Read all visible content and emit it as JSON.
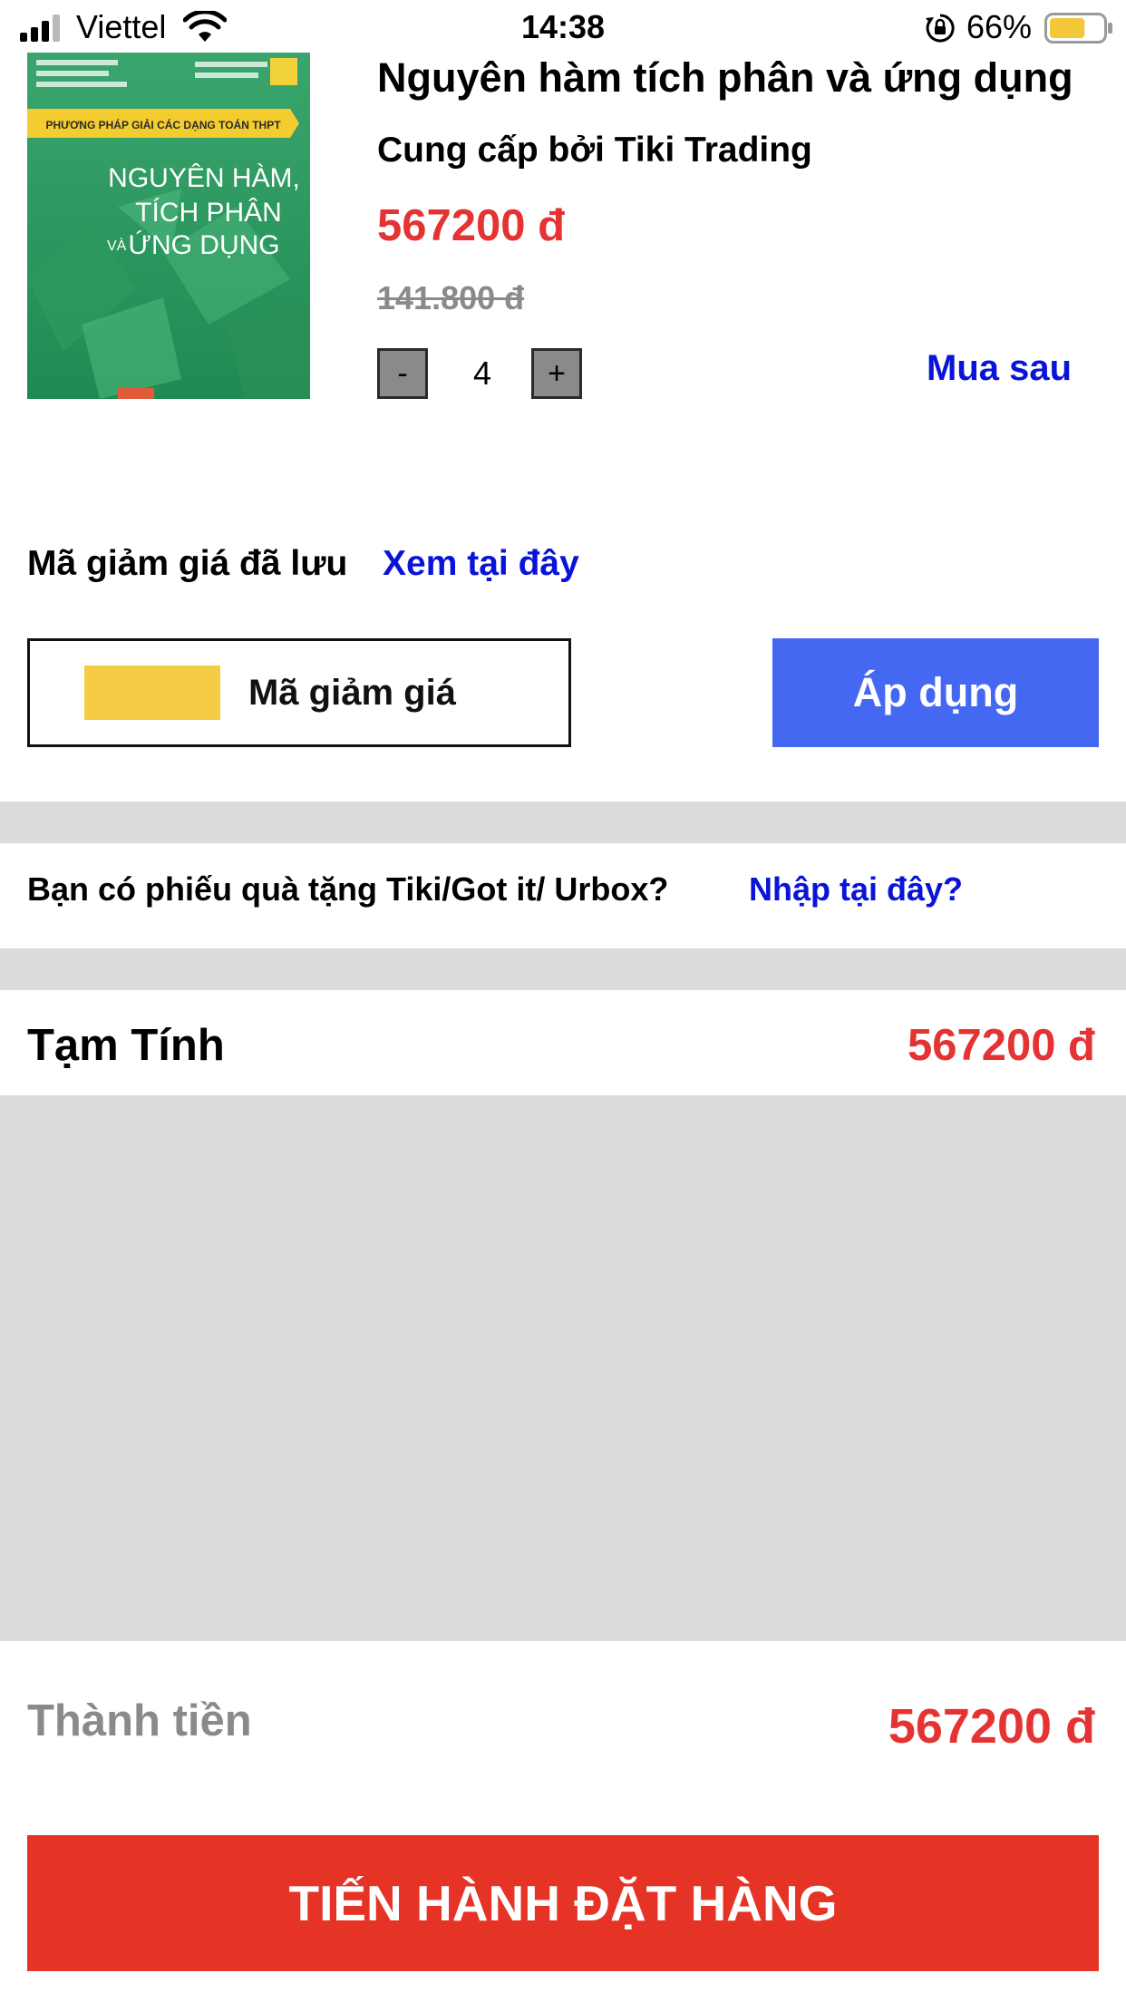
{
  "status_bar": {
    "carrier": "Viettel",
    "time": "14:38",
    "battery": "66%",
    "battery_level": 0.66,
    "icons": [
      "signal-icon",
      "wifi-icon",
      "orientation-lock-icon",
      "battery-icon"
    ]
  },
  "product": {
    "cover": {
      "series": "PHƯƠNG PHÁP GIẢI CÁC DẠNG TOÁN THPT",
      "line1": "NGUYÊN HÀM,",
      "line2": "TÍCH PHÂN",
      "line3_small": "VÀ",
      "line3": "ỨNG DỤNG"
    },
    "title": "Nguyên hàm tích phân và ứng dụng",
    "seller": "Cung cấp bởi Tiki Trading",
    "price": "567200 đ",
    "old_price": "141.800 đ",
    "quantity": "4",
    "minus_label": "-",
    "plus_label": "+",
    "buy_later": "Mua sau"
  },
  "coupon": {
    "saved_label": "Mã giảm giá đã lưu",
    "saved_link": "Xem tại đây",
    "placeholder": "Mã giảm giá",
    "apply_label": "Áp dụng"
  },
  "gift": {
    "question": "Bạn có phiếu quà tặng Tiki/Got it/ Urbox?",
    "link": "Nhập tại đây?"
  },
  "subtotal": {
    "label": "Tạm Tính",
    "value": "567200 đ"
  },
  "total": {
    "label": "Thành tiền",
    "value": "567200 đ"
  },
  "checkout_label": "TIẾN HÀNH ĐẶT HÀNG",
  "colors": {
    "price_red": "#e53333",
    "link_blue": "#0a14d8",
    "apply_blue": "#4468f1",
    "checkout_red": "#e53326",
    "coupon_yellow": "#f5cd45",
    "divider_grey": "#dcdcdc"
  }
}
